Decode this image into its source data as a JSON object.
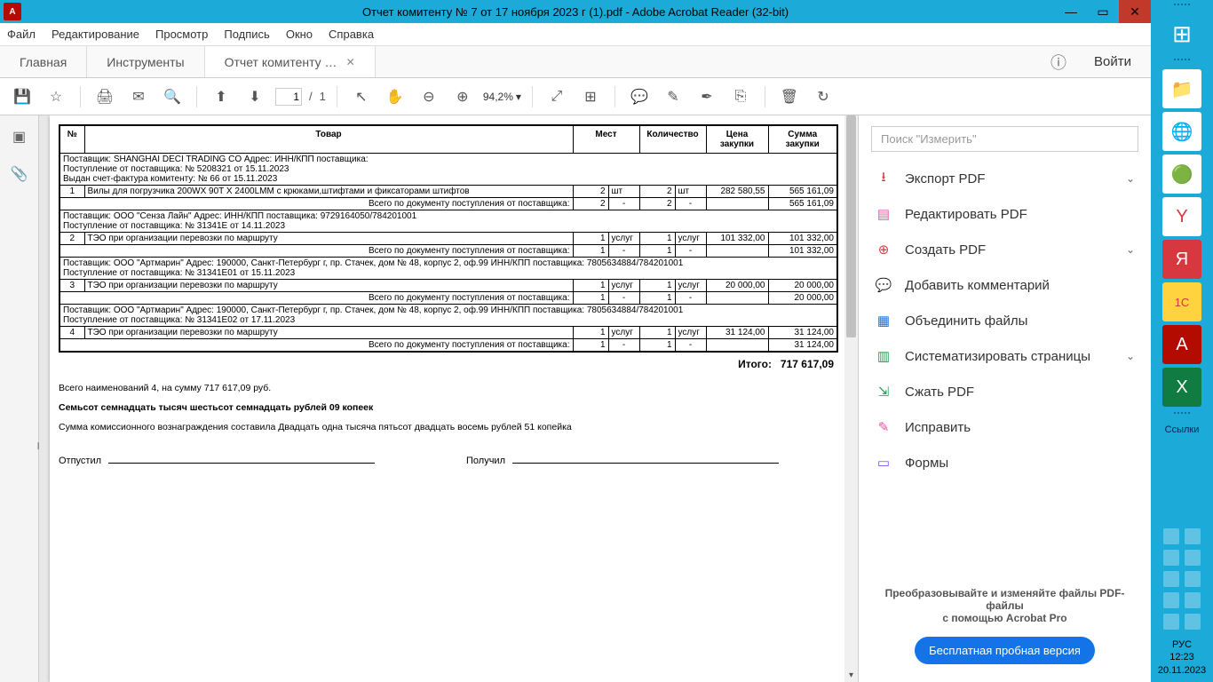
{
  "window": {
    "title": "Отчет комитенту № 7 от 17 ноября 2023 г (1).pdf - Adobe Acrobat Reader (32-bit)"
  },
  "menu": {
    "file": "Файл",
    "edit": "Редактирование",
    "view": "Просмотр",
    "sign": "Подпись",
    "window": "Окно",
    "help": "Справка"
  },
  "tabs": {
    "home": "Главная",
    "tools": "Инструменты",
    "doc": "Отчет комитенту …"
  },
  "signin": "Войти",
  "toolbar": {
    "page_current": "1",
    "page_sep": "/",
    "page_total": "1",
    "zoom": "94,2%"
  },
  "search_placeholder": "Поиск \"Измерить\"",
  "tools_list": {
    "export_pdf": "Экспорт PDF",
    "edit_pdf": "Редактировать PDF",
    "create_pdf": "Создать PDF",
    "add_comment": "Добавить комментарий",
    "combine": "Объединить файлы",
    "organize": "Систематизировать страницы",
    "compress": "Сжать PDF",
    "fix": "Исправить",
    "forms": "Формы"
  },
  "promo": {
    "line1": "Преобразовывайте и изменяйте файлы PDF-файлы",
    "line2": "с помощью Acrobat Pro",
    "cta": "Бесплатная пробная версия"
  },
  "os": {
    "links": "Ссылки",
    "lang": "РУС",
    "time": "12:23",
    "date": "20.11.2023"
  },
  "doc": {
    "headers": {
      "num": "№",
      "product": "Товар",
      "places": "Мест",
      "qty": "Количество",
      "price": "Цена закупки",
      "sum": "Сумма закупки"
    },
    "blocks": [
      {
        "supplier_lines": [
          "Поставщик: SHANGHAI DECI TRADING CO Адрес:  ИНН/КПП поставщика:",
          "Поступление от поставщика: № 5208321 от 15.11.2023",
          "Выдан счет-фактура комитенту: № 66 от 15.11.2023"
        ],
        "rows": [
          {
            "n": "1",
            "name": "Вилы для погрузчика  200WX 90T X 2400LMM с крюками,штифтами и фиксаторами штифтов",
            "places": "2",
            "places_u": "шт",
            "qty": "2",
            "qty_u": "шт",
            "price": "282 580,55",
            "sum": "565 161,09"
          }
        ],
        "subtotal_label": "Всего по документу поступления от поставщика:",
        "subtotal": {
          "places": "2",
          "places_u": "-",
          "qty": "2",
          "qty_u": "-",
          "price": "",
          "sum": "565 161,09"
        }
      },
      {
        "supplier_lines": [
          "Поставщик: ООО \"Сенза Лайн\" Адрес:  ИНН/КПП поставщика: 9729164050/784201001",
          "Поступление от поставщика: № 31341Е от 14.11.2023"
        ],
        "rows": [
          {
            "n": "2",
            "name": "ТЭО при организации перевозки по маршруту",
            "places": "1",
            "places_u": "услуг",
            "qty": "1",
            "qty_u": "услуг",
            "price": "101 332,00",
            "sum": "101 332,00"
          }
        ],
        "subtotal_label": "Всего по документу поступления от поставщика:",
        "subtotal": {
          "places": "1",
          "places_u": "-",
          "qty": "1",
          "qty_u": "-",
          "price": "",
          "sum": "101 332,00"
        }
      },
      {
        "supplier_lines": [
          "Поставщик: ООО \"Артмарин\" Адрес: 190000, Санкт-Петербург г, пр. Стачек, дом № 48, корпус 2, оф.99 ИНН/КПП поставщика: 7805634884/784201001",
          "Поступление от поставщика: № 31341Е01  от 15.11.2023"
        ],
        "rows": [
          {
            "n": "3",
            "name": "ТЭО при организации перевозки по маршруту",
            "places": "1",
            "places_u": "услуг",
            "qty": "1",
            "qty_u": "услуг",
            "price": "20 000,00",
            "sum": "20 000,00"
          }
        ],
        "subtotal_label": "Всего по документу поступления от поставщика:",
        "subtotal": {
          "places": "1",
          "places_u": "-",
          "qty": "1",
          "qty_u": "-",
          "price": "",
          "sum": "20 000,00"
        }
      },
      {
        "supplier_lines": [
          "Поставщик: ООО \"Артмарин\" Адрес: 190000, Санкт-Петербург г, пр. Стачек, дом № 48, корпус 2, оф.99 ИНН/КПП поставщика: 7805634884/784201001",
          "Поступление от поставщика: № 31341Е02 от 17.11.2023"
        ],
        "rows": [
          {
            "n": "4",
            "name": "ТЭО при организации перевозки по маршруту",
            "places": "1",
            "places_u": "услуг",
            "qty": "1",
            "qty_u": "услуг",
            "price": "31 124,00",
            "sum": "31 124,00"
          }
        ],
        "subtotal_label": "Всего по документу поступления от поставщика:",
        "subtotal": {
          "places": "1",
          "places_u": "-",
          "qty": "1",
          "qty_u": "-",
          "price": "",
          "sum": "31 124,00"
        }
      }
    ],
    "total_label": "Итого:",
    "total": "717 617,09",
    "summary1": "Всего наименований 4, на сумму 717 617,09 руб.",
    "summary2": "Семьсот семнадцать тысяч шестьсот семнадцать рублей 09 копеек",
    "summary3": "Сумма комиссионного вознаграждения составила Двадцать одна тысяча пятьсот двадцать восемь рублей 51 копейка",
    "sign_out": "Отпустил",
    "sign_in": "Получил"
  }
}
